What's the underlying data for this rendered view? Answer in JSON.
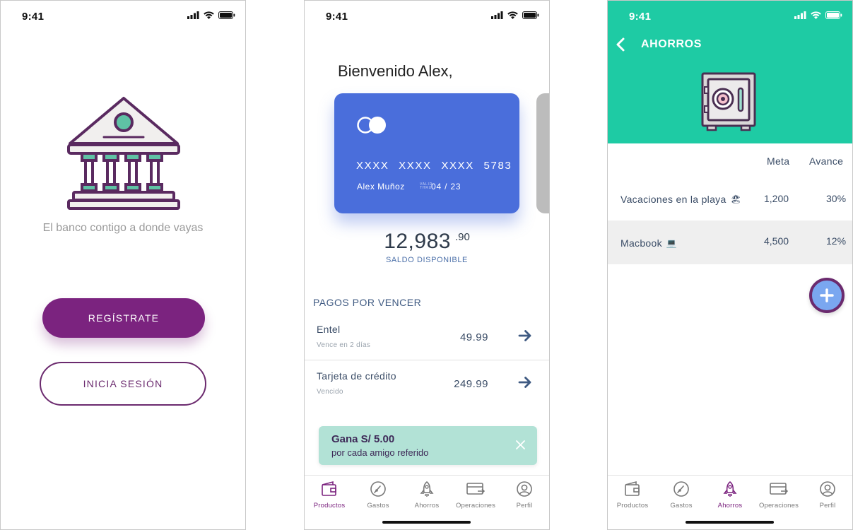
{
  "status_bar": {
    "time": "9:41"
  },
  "screen_welcome": {
    "tagline": "El banco contigo a donde vayas",
    "register_label": "REGÍSTRATE",
    "login_label": "INICIA SESIÓN",
    "colors": {
      "primary": "#7b237f",
      "accent": "#5fc2a5"
    },
    "icons": [
      "bank-icon"
    ]
  },
  "screen_home": {
    "welcome": "Bienvenido Alex,",
    "card": {
      "number": "XXXX XXXX XXXX 5783",
      "holder": "Alex Muñoz",
      "expiry_label": "VALID THRU",
      "expiry": "04 / 23",
      "color": "#4a6edb"
    },
    "balance": {
      "amount": "12,983",
      "cents": ".90",
      "label": "SALDO DISPONIBLE"
    },
    "payments_title": "PAGOS POR VENCER",
    "payments": [
      {
        "name": "Entel",
        "status": "Vence en 2 días",
        "amount": "49.99"
      },
      {
        "name": "Tarjeta de crédito",
        "status": "Vencido",
        "amount": "249.99"
      }
    ],
    "promo": {
      "title": "Gana S/ 5.00",
      "subtitle": "por cada amigo referido",
      "color": "#b2e2d6"
    }
  },
  "screen_savings": {
    "title": "AHORROS",
    "header_color": "#1ecba4",
    "columns": {
      "goal": "Meta",
      "progress": "Avance"
    },
    "goals": [
      {
        "name": "Vacaciones en la playa",
        "emoji": "🏖",
        "goal": "1,200",
        "progress": "30%"
      },
      {
        "name": "Macbook",
        "emoji": "💻",
        "goal": "4,500",
        "progress": "12%"
      }
    ],
    "fab_icon": "plus-icon"
  },
  "tabs": [
    {
      "label": "Productos",
      "icon": "wallet-icon"
    },
    {
      "label": "Gastos",
      "icon": "gauge-icon"
    },
    {
      "label": "Ahorros",
      "icon": "rocket-icon"
    },
    {
      "label": "Operaciones",
      "icon": "card-transfer-icon"
    },
    {
      "label": "Perfil",
      "icon": "profile-icon"
    }
  ]
}
